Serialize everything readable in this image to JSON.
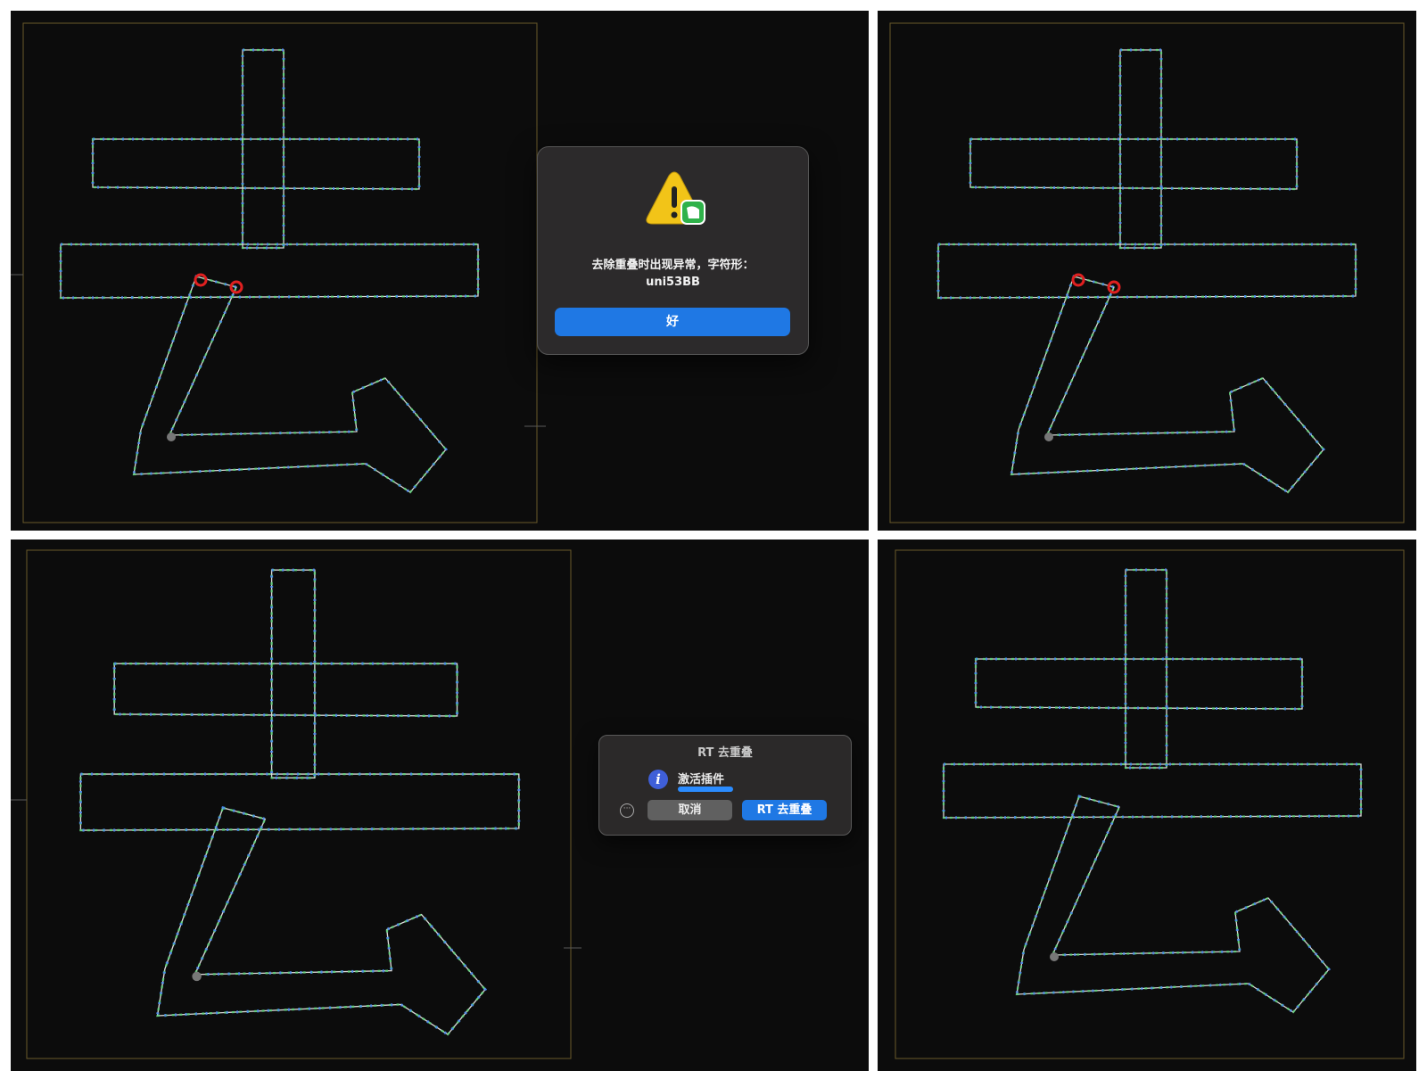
{
  "alert": {
    "icon": "warning-icon",
    "message_line1": "去除重叠时出现异常，字符形：",
    "message_line2": "uni53BB",
    "ok_label": "好"
  },
  "plugin_dialog": {
    "title": "RT 去重叠",
    "info_icon": "info-icon",
    "status_label": "激活插件",
    "progress": 1.0,
    "more_icon": "ellipsis-icon",
    "cancel_label": "取消",
    "run_label": "RT 去重叠"
  },
  "colors": {
    "canvas": "#0c0c0c",
    "node_green": "#5fd07a",
    "node_blue": "#4a8cf0",
    "error_red": "#e02020",
    "button_blue": "#1f78e4"
  }
}
